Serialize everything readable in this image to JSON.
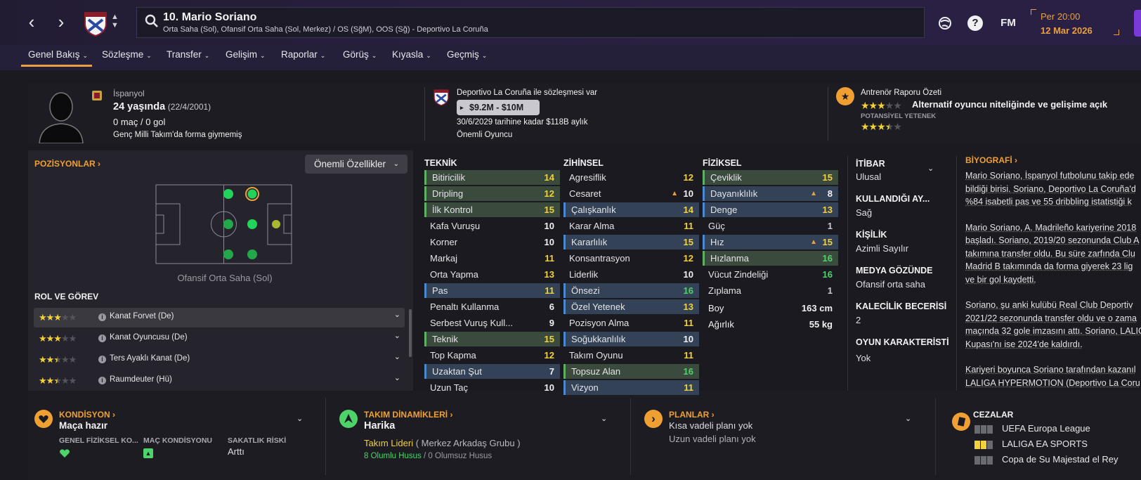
{
  "topbar": {
    "player_title": "10. Mario Soriano",
    "player_subtitle": "Orta Saha (Sol), Ofansif Orta Saha (Sol, Merkez) / OS (SğM), OOS (Sğ) - Deportivo La Coruña",
    "day_time": "Per 20:00",
    "date": "12 Mar 2026",
    "fm_label": "FM",
    "help_label": "?"
  },
  "tabs": [
    "Genel Bakış",
    "Sözleşme",
    "Transfer",
    "Gelişim",
    "Raporlar",
    "Görüş",
    "Kıyasla",
    "Geçmiş"
  ],
  "header": {
    "nationality": "İspanyol",
    "age": "24 yaşında",
    "birth": "(22/4/2001)",
    "apps": "0 maç / 0 gol",
    "intl": "Genç Milli Takım'da forma giymemiş",
    "contract_club": "Deportivo La Coruña ile sözleşmesi var",
    "value": "$9.2M - $10M",
    "contract_until": "30/6/2029 tarihine kadar $118B aylık",
    "squad_status": "Önemli Oyuncu",
    "coach_title": "Antrenör Raporu Özeti",
    "coach_summary": "Alternatif oyuncu niteliğinde ve gelişime açık",
    "potential_label": "POTANSİYEL YETENEK",
    "ability_stars": 3,
    "potential_stars": 3.5
  },
  "positions": {
    "title": "POZİSYONLAR",
    "key_attr_button": "Önemli Özellikler",
    "position_label": "Ofansif Orta Saha (Sol)",
    "role_title": "ROL VE GÖREV",
    "roles": [
      {
        "name": "Kanat Forvet (De)",
        "stars": 3
      },
      {
        "name": "Kanat Oyuncusu (De)",
        "stars": 3
      },
      {
        "name": "Ters Ayaklı Kanat (De)",
        "stars": 2.5
      },
      {
        "name": "Raumdeuter (Hü)",
        "stars": 2.5
      }
    ]
  },
  "attributes": {
    "technical": {
      "title": "TEKNİK",
      "rows": [
        [
          "Bitiricilik",
          "14",
          "g",
          "y"
        ],
        [
          "Dripling",
          "12",
          "g",
          "y"
        ],
        [
          "İlk Kontrol",
          "15",
          "g",
          "y"
        ],
        [
          "Kafa Vuruşu",
          "10",
          "",
          ""
        ],
        [
          "Korner",
          "10",
          "",
          ""
        ],
        [
          "Markaj",
          "11",
          "",
          "y"
        ],
        [
          "Orta Yapma",
          "13",
          "",
          "y"
        ],
        [
          "Pas",
          "11",
          "b",
          "y"
        ],
        [
          "Penaltı Kullanma",
          "6",
          "",
          ""
        ],
        [
          "Serbest Vuruş Kull...",
          "9",
          "",
          ""
        ],
        [
          "Teknik",
          "15",
          "g",
          "y"
        ],
        [
          "Top Kapma",
          "12",
          "",
          "y"
        ],
        [
          "Uzaktan Şut",
          "7",
          "b",
          ""
        ],
        [
          "Uzun Taç",
          "10",
          "",
          ""
        ]
      ]
    },
    "mental": {
      "title": "ZİHİNSEL",
      "rows": [
        [
          "Agresiflik",
          "12",
          "",
          "y"
        ],
        [
          "Cesaret",
          "10",
          "",
          ""
        ],
        [
          "Çalışkanlık",
          "14",
          "b",
          "y"
        ],
        [
          "Karar Alma",
          "11",
          "",
          "y"
        ],
        [
          "Kararlılık",
          "15",
          "b",
          "y"
        ],
        [
          "Konsantrasyon",
          "12",
          "",
          "y"
        ],
        [
          "Liderlik",
          "10",
          "",
          ""
        ],
        [
          "Önsezi",
          "16",
          "b",
          "g"
        ],
        [
          "Özel Yetenek",
          "13",
          "b",
          "y"
        ],
        [
          "Pozisyon Alma",
          "11",
          "",
          "y"
        ],
        [
          "Soğukkanlılık",
          "10",
          "b",
          ""
        ],
        [
          "Takım Oyunu",
          "11",
          "",
          "y"
        ],
        [
          "Topsuz Alan",
          "16",
          "g",
          "g"
        ],
        [
          "Vizyon",
          "11",
          "b",
          "y"
        ]
      ]
    },
    "physical": {
      "title": "FİZİKSEL",
      "rows": [
        [
          "Çeviklik",
          "15",
          "g",
          "y"
        ],
        [
          "Dayanıklılık",
          "8",
          "b",
          ""
        ],
        [
          "Denge",
          "13",
          "b",
          "y"
        ],
        [
          "Güç",
          "1",
          "",
          "r"
        ],
        [
          "Hız",
          "15",
          "b",
          "y"
        ],
        [
          "Hızlanma",
          "16",
          "g",
          "g"
        ],
        [
          "Vücut Zindeliği",
          "16",
          "",
          "g"
        ],
        [
          "Zıplama",
          "1",
          "",
          "r"
        ]
      ]
    },
    "height_label": "Boy",
    "height": "163 cm",
    "weight_label": "Ağırlık",
    "weight": "55 kg"
  },
  "side": {
    "rep_label": "İTİBAR",
    "rep": "Ulusal",
    "foot_label": "KULLANDIĞI AY...",
    "foot": "Sağ",
    "pers_label": "KİŞİLİK",
    "pers": "Azimli Sayılır",
    "media_label": "MEDYA GÖZÜNDE",
    "media": "Ofansif orta saha",
    "gk_label": "KALECİLİK BECERİSİ",
    "gk": "2",
    "char_label": "OYUN KARAKTERİSTİ",
    "char": "Yok"
  },
  "bio": {
    "title": "BİYOGRAFİ",
    "p1": [
      "Mario Soriano, İspanyol futbolunu takip ede",
      "bildiği birisi. Soriano, Deportivo La Coruña'd",
      "%84 isabetli pas ve 55 dribbling istatistiği k"
    ],
    "p2": [
      "Mario Soriano, A. Madrileño kariyerine 2018",
      "başladı. Soriano, 2019/20 sezonunda Club A",
      "takımına transfer oldu. Bu süre zarfında Clu",
      "Madrid B takımında da forma giyerek 23 lig",
      "ve bir gol kaydetti."
    ],
    "p3": [
      "Soriano, şu anki kulübü Real Club Deportiv",
      "2021/22 sezonunda transfer oldu ve o zama",
      "maçında 32 gole imzasını attı. Soriano, LALIG",
      "Kupası'nı ise 2024'de kaldırdı."
    ],
    "p4": [
      "Kariyeri boyunca Soriano tarafından kazanıl",
      "LALIGA HYPERMOTION (Deportivo La Coru"
    ]
  },
  "bottom": {
    "cond_title": "KONDİSYON",
    "cond_value": "Maça hazır",
    "c1": "GENEL FİZİKSEL KO...",
    "c2": "MAÇ KONDİSYONU",
    "c3": "SAKATLIK RİSKİ",
    "c3v": "Arttı",
    "dyn_title": "TAKIM DİNAMİKLERİ",
    "dyn_value": "Harika",
    "dyn_role": "Takım Lideri",
    "dyn_group": "( Merkez Arkadaş Grubu )",
    "dyn_pos": "8 Olumlu Husus",
    "dyn_sep": "/",
    "dyn_neg": "0 Olumsuz Husus",
    "plan_title": "PLANLAR",
    "plan1": "Kısa vadeli planı yok",
    "plan2": "Uzun vadeli planı yok",
    "ban_title": "CEZALAR",
    "bans": [
      "UEFA Europa League",
      "LALIGA EA SPORTS",
      "Copa de Su Majestad el Rey"
    ]
  },
  "colors": {
    "accent": "#f0a033",
    "yellow": "#f2d23a",
    "green": "#4ed36a"
  }
}
